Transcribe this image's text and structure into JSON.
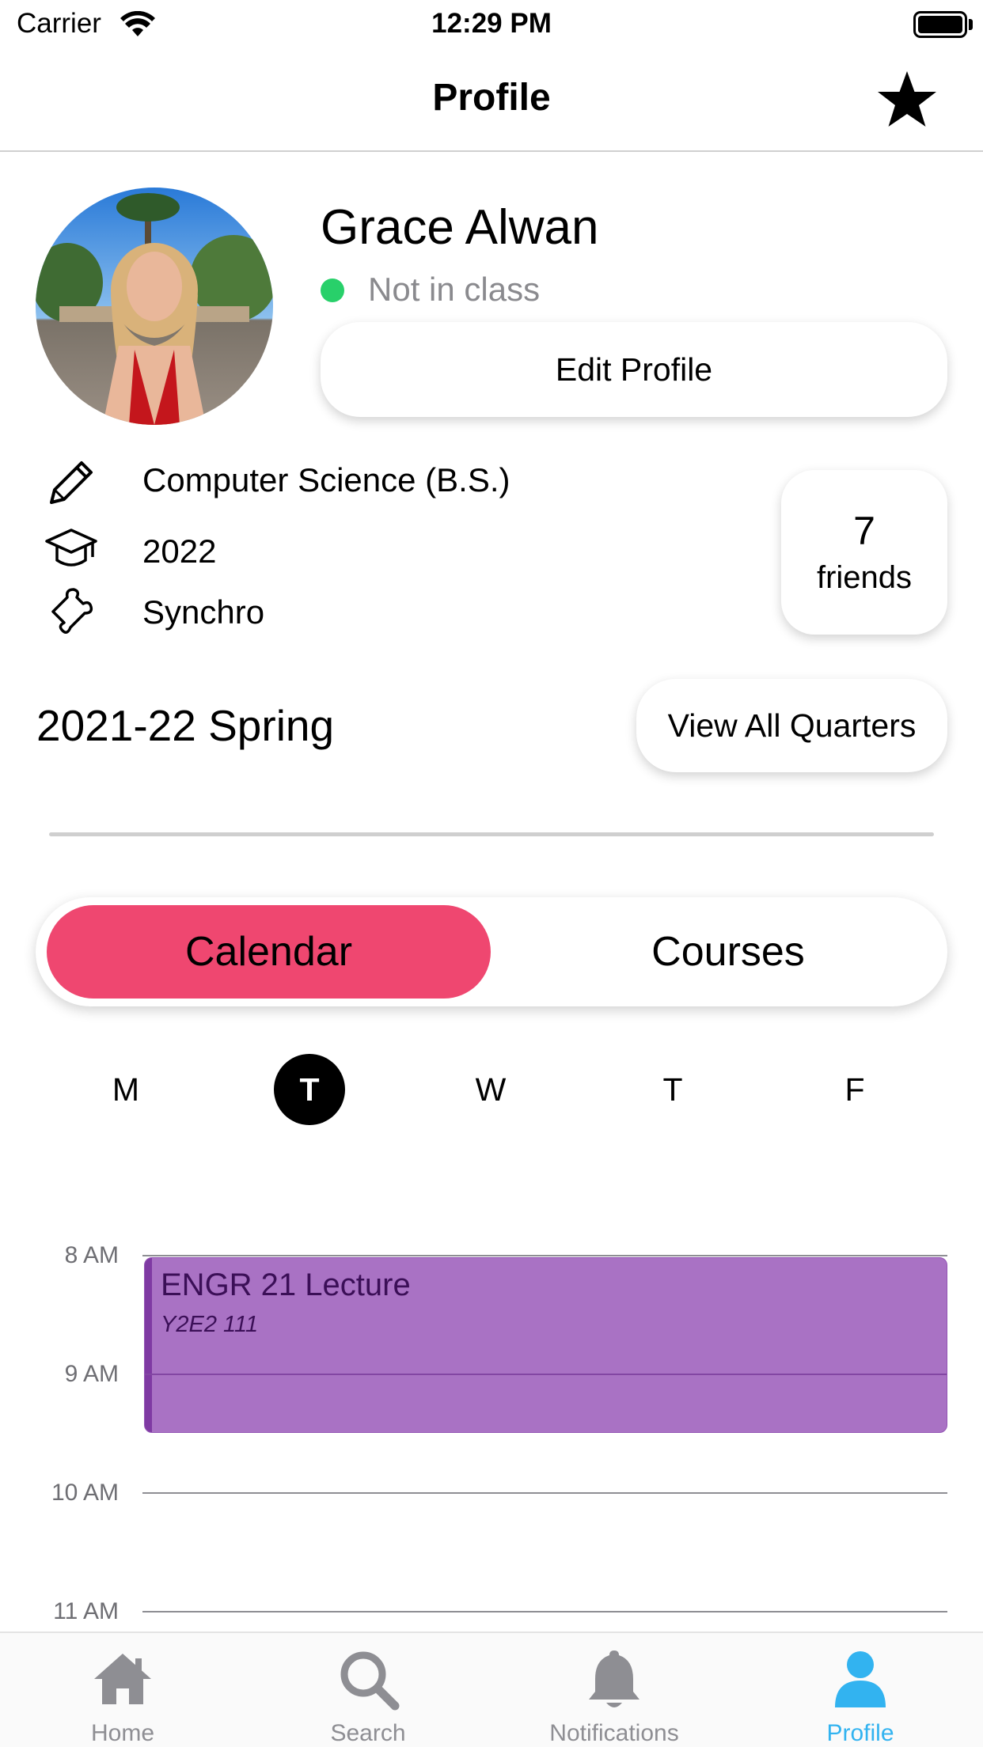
{
  "status_bar": {
    "carrier": "Carrier",
    "time": "12:29 PM"
  },
  "nav": {
    "title": "Profile",
    "favorite_icon": "star-icon"
  },
  "profile": {
    "name": "Grace Alwan",
    "status": "Not in class",
    "status_color": "#28d06a",
    "edit_label": "Edit Profile",
    "major": "Computer Science (B.S.)",
    "class_year": "2022",
    "activity": "Synchro",
    "friends_count": "7",
    "friends_label": "friends"
  },
  "term": {
    "label": "2021-22 Spring",
    "view_all_label": "View All Quarters"
  },
  "segment": {
    "calendar": "Calendar",
    "courses": "Courses",
    "active": "calendar",
    "accent": "#ef4770"
  },
  "days": [
    {
      "label": "M",
      "selected": false
    },
    {
      "label": "T",
      "selected": true
    },
    {
      "label": "W",
      "selected": false
    },
    {
      "label": "T",
      "selected": false
    },
    {
      "label": "F",
      "selected": false
    }
  ],
  "timeline": {
    "hours": [
      "8 AM",
      "9 AM",
      "10 AM",
      "11 AM"
    ],
    "event": {
      "title": "ENGR 21 Lecture",
      "location": "Y2E2 111",
      "color": "#a972c4"
    }
  },
  "tabbar": {
    "tabs": [
      {
        "label": "Home",
        "icon": "home-icon",
        "active": false
      },
      {
        "label": "Search",
        "icon": "search-icon",
        "active": false
      },
      {
        "label": "Notifications",
        "icon": "bell-icon",
        "active": false
      },
      {
        "label": "Profile",
        "icon": "person-icon",
        "active": true
      }
    ],
    "active_color": "#32b3f0"
  }
}
